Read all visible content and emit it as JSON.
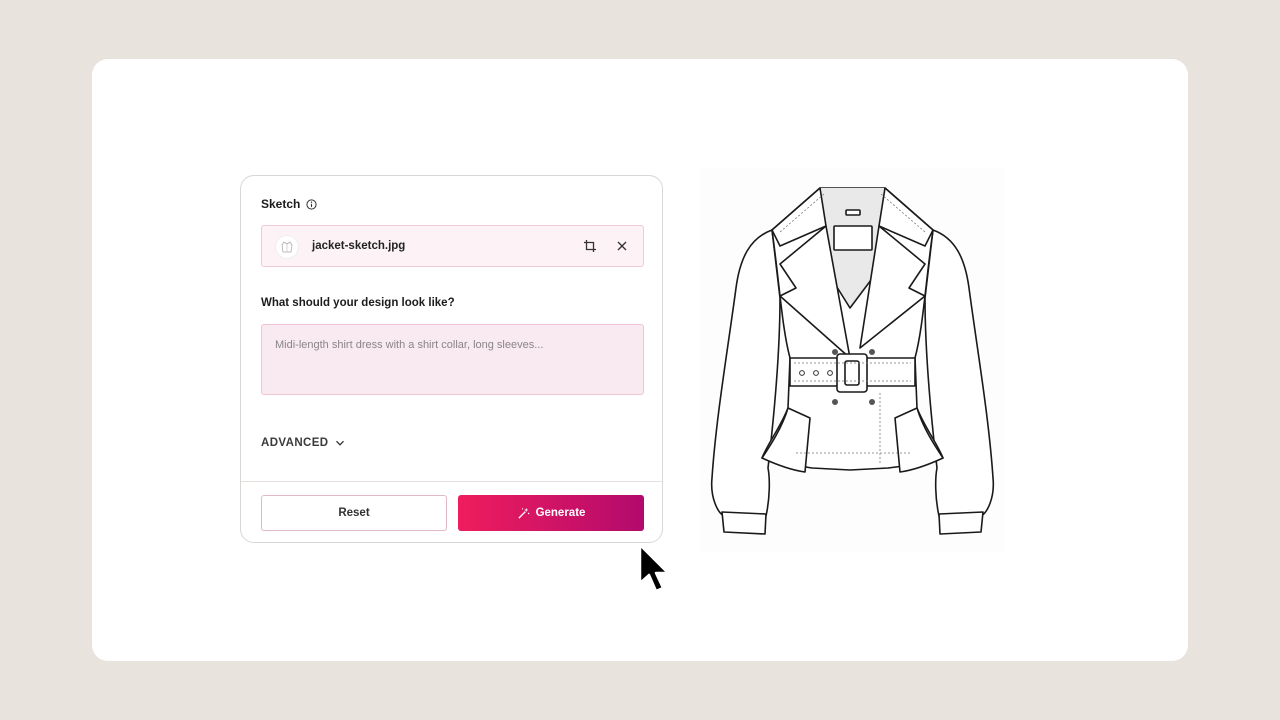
{
  "sketch_section": {
    "label": "Sketch",
    "info_icon": "info-icon",
    "file": {
      "name": "jacket-sketch.jpg",
      "crop_icon": "crop-icon",
      "remove_icon": "close-icon"
    }
  },
  "design_prompt": {
    "question": "What should your design look like?",
    "placeholder": "Midi-length shirt dress with a shirt collar, long sleeves..."
  },
  "advanced": {
    "label": "ADVANCED",
    "icon": "chevron-down-icon"
  },
  "actions": {
    "reset_label": "Reset",
    "generate_label": "Generate",
    "generate_icon": "magic-wand-icon"
  },
  "colors": {
    "background": "#e8e3dc",
    "accent_start": "#ef1d5d",
    "accent_end": "#b30a6d",
    "field_bg": "#f8eaf0"
  }
}
